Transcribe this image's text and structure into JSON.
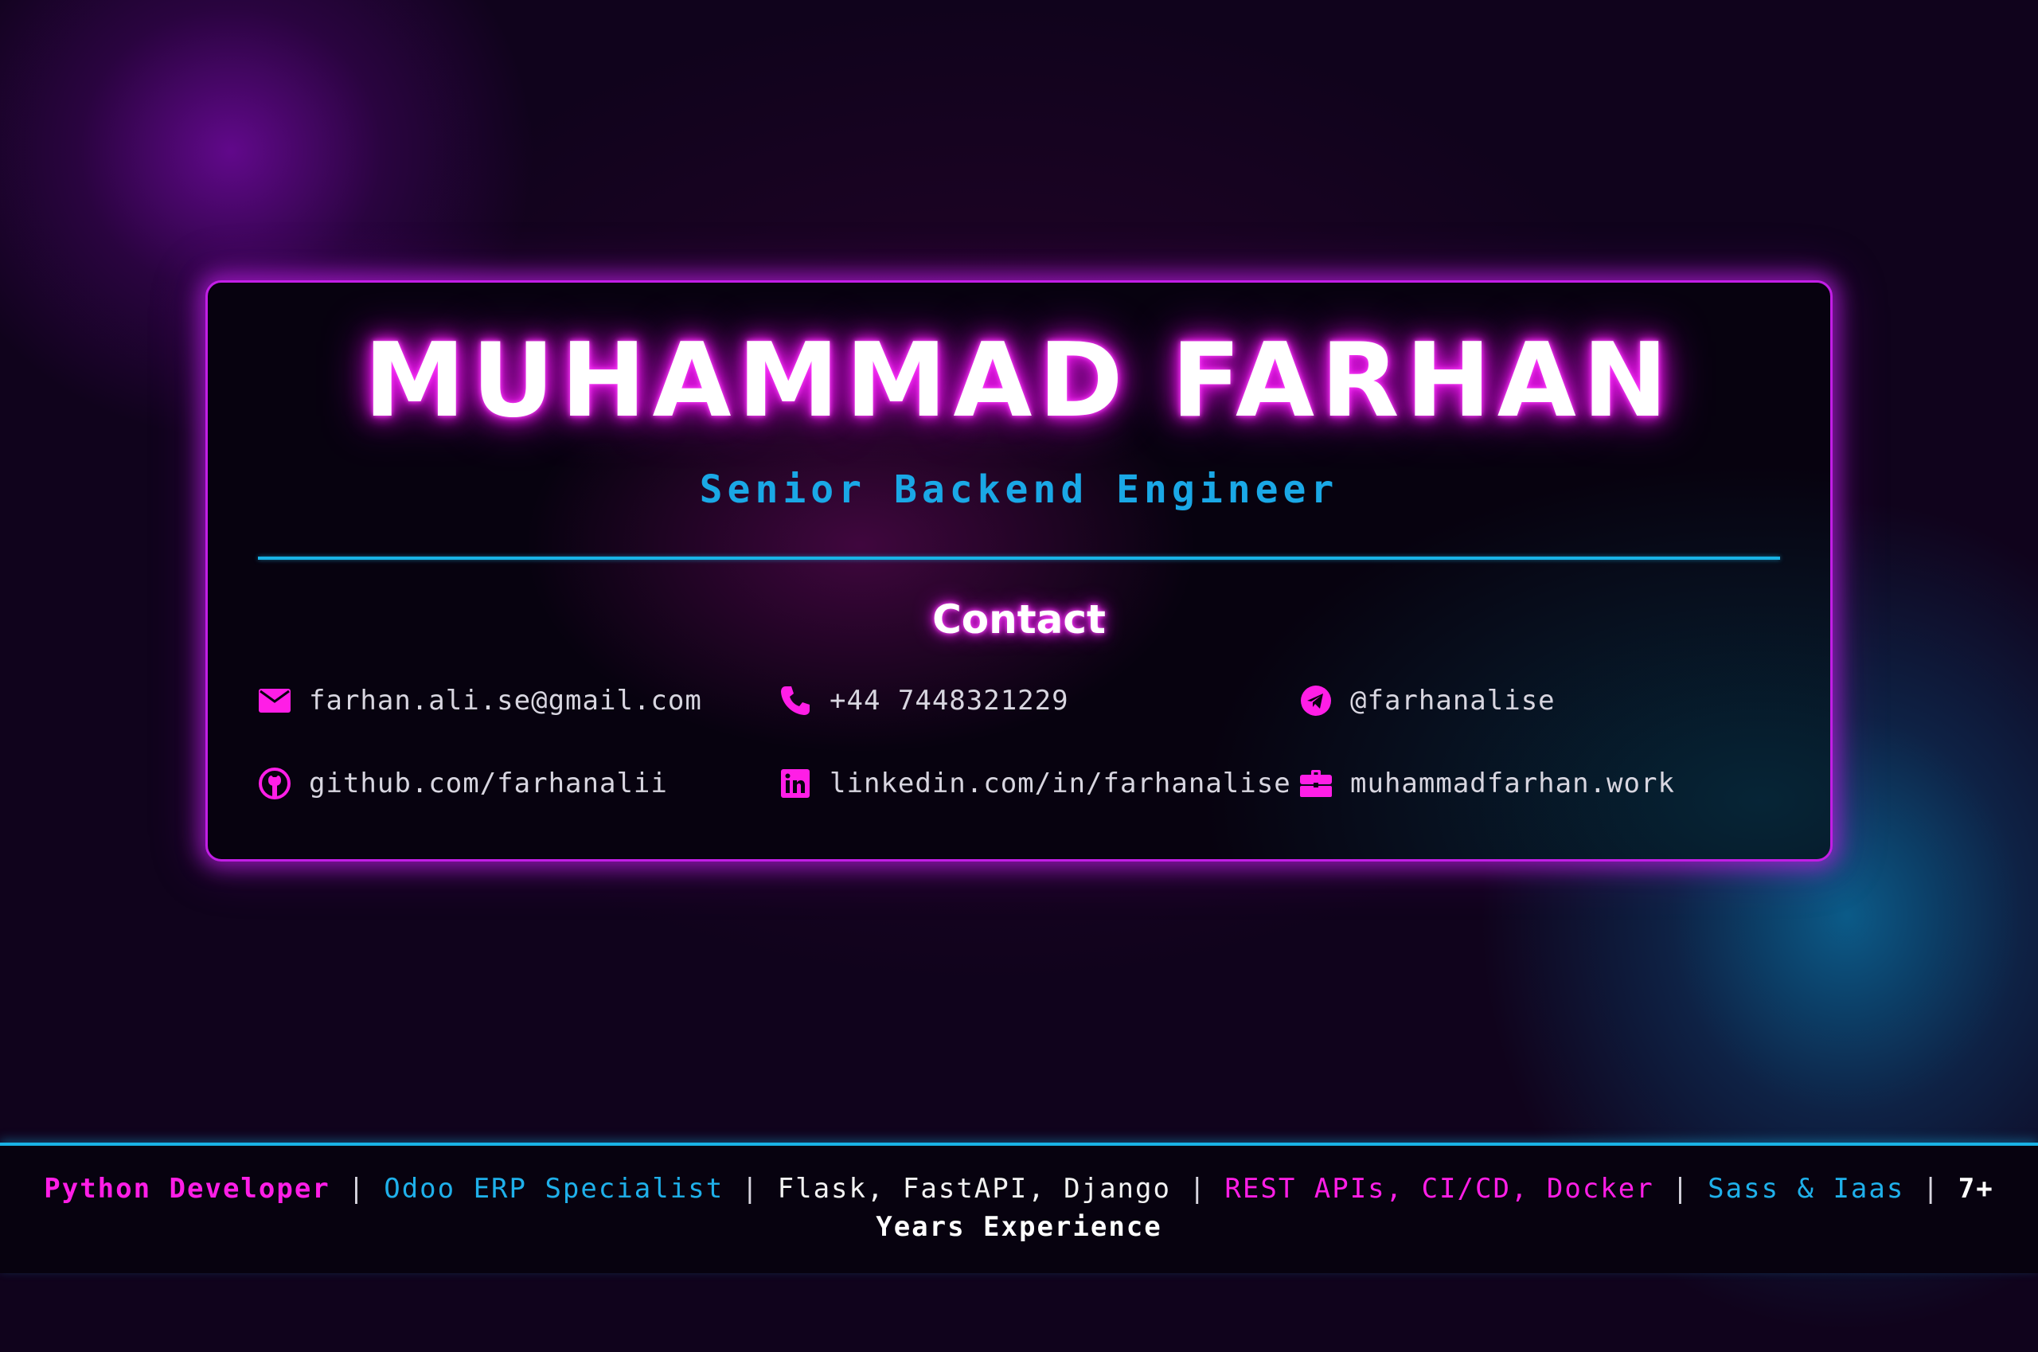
{
  "profile": {
    "name": "MUHAMMAD FARHAN",
    "title": "Senior Backend Engineer"
  },
  "contact": {
    "heading": "Contact",
    "items": [
      {
        "icon": "envelope-icon",
        "label": "farhan.ali.se@gmail.com"
      },
      {
        "icon": "phone-icon",
        "label": "+44 7448321229"
      },
      {
        "icon": "telegram-icon",
        "label": "@farhanalise"
      },
      {
        "icon": "github-icon",
        "label": "github.com/farhanalii"
      },
      {
        "icon": "linkedin-icon",
        "label": "linkedin.com/in/farhanalise"
      },
      {
        "icon": "briefcase-icon",
        "label": "muhammadfarhan.work"
      }
    ]
  },
  "footer": {
    "separator": "|",
    "segments": [
      {
        "text": "Python Developer",
        "color": "#ff1ee6",
        "bold": true
      },
      {
        "text": "Odoo ERP Specialist",
        "color": "#1fb0ea",
        "bold": false
      },
      {
        "text": "Flask, FastAPI, Django",
        "color": "#f2f2f2",
        "bold": false
      },
      {
        "text": "REST APIs, CI/CD, Docker",
        "color": "#ff1ee6",
        "bold": false
      },
      {
        "text": "Sass & Iaas",
        "color": "#1fb0ea",
        "bold": false
      },
      {
        "text": "7+ Years Experience",
        "color": "#ffffff",
        "bold": true
      }
    ]
  },
  "colors": {
    "neon_pink": "#ff1ee6",
    "neon_blue": "#19b3e6",
    "card_border": "#c21ee6",
    "background": "#10031c"
  }
}
